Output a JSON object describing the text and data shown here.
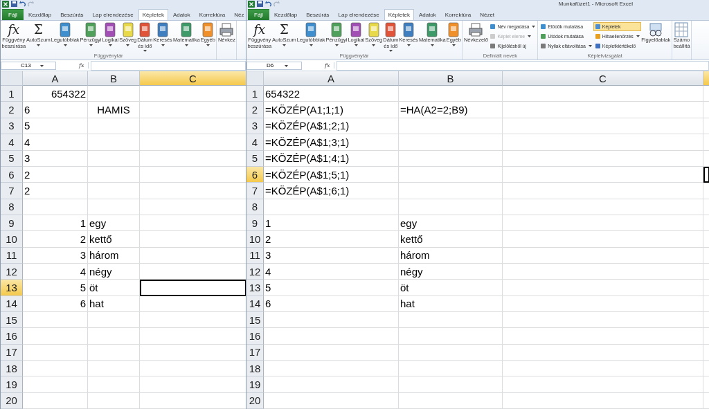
{
  "windows": [
    {
      "tabs": [
        {
          "label": "Fájl",
          "kind": "file",
          "selected": false
        },
        {
          "label": "Kezdőlap",
          "selected": false
        },
        {
          "label": "Beszúrás",
          "selected": false
        },
        {
          "label": "Lap elrendezése",
          "selected": false
        },
        {
          "label": "Képletek",
          "selected": true
        },
        {
          "label": "Adatok",
          "selected": false
        },
        {
          "label": "Korrektúra",
          "selected": false
        },
        {
          "label": "Néz",
          "selected": false
        }
      ],
      "ribbon": {
        "groups": [
          {
            "label": "Függvénytár",
            "buttons": [
              {
                "kind": "large",
                "lines": [
                  "Függvény",
                  "beszúrása"
                ],
                "glyph": "fx",
                "dropdown": false
              },
              {
                "kind": "large",
                "lines": [
                  "AutoSzum"
                ],
                "glyph": "Σ",
                "dropdown": true
              },
              {
                "kind": "large",
                "lines": [
                  "Legutóbbiak"
                ],
                "dropdown": true
              },
              {
                "kind": "large",
                "lines": [
                  "Pénzügyi"
                ],
                "dropdown": true
              },
              {
                "kind": "large",
                "lines": [
                  "Logikai"
                ],
                "dropdown": true
              },
              {
                "kind": "large",
                "lines": [
                  "Szöveg"
                ],
                "dropdown": true
              },
              {
                "kind": "large",
                "lines": [
                  "Dátum",
                  "és idő"
                ],
                "dropdown": true
              },
              {
                "kind": "large",
                "lines": [
                  "Keresés"
                ],
                "dropdown": true
              },
              {
                "kind": "large",
                "lines": [
                  "Matematika"
                ],
                "dropdown": true
              },
              {
                "kind": "large",
                "lines": [
                  "Egyéb"
                ],
                "dropdown": true
              }
            ]
          },
          {
            "buttons": [
              {
                "kind": "large",
                "lines": [
                  "Névkez"
                ],
                "dropdown": false
              }
            ]
          }
        ]
      },
      "name_box": "C13",
      "formula_bar": {
        "glyph": "fx"
      },
      "show_formulas": false,
      "columns": [
        {
          "label": "A",
          "selected": false
        },
        {
          "label": "B",
          "selected": false
        },
        {
          "label": "C",
          "selected": true
        }
      ],
      "rows": [
        {
          "number": "1",
          "selected": false,
          "cells": [
            {
              "text": "654322",
              "kind": "number"
            }
          ]
        },
        {
          "number": "2",
          "selected": false,
          "cells": [
            {
              "text": "6",
              "kind": "text"
            },
            {
              "text": "HAMIS",
              "kind": "logical"
            }
          ]
        },
        {
          "number": "3",
          "selected": false,
          "cells": [
            {
              "text": "5",
              "kind": "text"
            }
          ]
        },
        {
          "number": "4",
          "selected": false,
          "cells": [
            {
              "text": "4",
              "kind": "text"
            }
          ]
        },
        {
          "number": "5",
          "selected": false,
          "cells": [
            {
              "text": "3",
              "kind": "text"
            }
          ]
        },
        {
          "number": "6",
          "selected": false,
          "cells": [
            {
              "text": "2",
              "kind": "text"
            }
          ]
        },
        {
          "number": "7",
          "selected": false,
          "cells": [
            {
              "text": "2",
              "kind": "text"
            }
          ]
        },
        {
          "number": "8",
          "selected": false,
          "cells": []
        },
        {
          "number": "9",
          "selected": false,
          "cells": [
            {
              "text": "1",
              "kind": "number"
            },
            {
              "text": "egy",
              "kind": "text"
            }
          ]
        },
        {
          "number": "10",
          "selected": false,
          "cells": [
            {
              "text": "2",
              "kind": "number"
            },
            {
              "text": "kettő",
              "kind": "text"
            }
          ]
        },
        {
          "number": "11",
          "selected": false,
          "cells": [
            {
              "text": "3",
              "kind": "number"
            },
            {
              "text": "három",
              "kind": "text"
            }
          ]
        },
        {
          "number": "12",
          "selected": false,
          "cells": [
            {
              "text": "4",
              "kind": "number"
            },
            {
              "text": "négy",
              "kind": "text"
            }
          ]
        },
        {
          "number": "13",
          "selected": true,
          "cells": [
            {
              "text": "5",
              "kind": "number"
            },
            {
              "text": "öt",
              "kind": "text"
            },
            {
              "selected": true
            }
          ]
        },
        {
          "number": "14",
          "selected": false,
          "cells": [
            {
              "text": "6",
              "kind": "number"
            },
            {
              "text": "hat",
              "kind": "text"
            }
          ]
        },
        {
          "number": "15",
          "selected": false,
          "cells": []
        },
        {
          "number": "16",
          "selected": false,
          "cells": []
        },
        {
          "number": "17",
          "selected": false,
          "cells": []
        },
        {
          "number": "18",
          "selected": false,
          "cells": []
        },
        {
          "number": "19",
          "selected": false,
          "cells": []
        },
        {
          "number": "20",
          "selected": false,
          "cells": []
        }
      ]
    },
    {
      "title": "Munkafüzet1  -  Microsoft Excel",
      "tabs": [
        {
          "label": "Fájl",
          "kind": "file",
          "selected": false
        },
        {
          "label": "Kezdőlap",
          "selected": false
        },
        {
          "label": "Beszúrás",
          "selected": false
        },
        {
          "label": "Lap elrendezése",
          "selected": false
        },
        {
          "label": "Képletek",
          "selected": true
        },
        {
          "label": "Adatok",
          "selected": false
        },
        {
          "label": "Korrektúra",
          "selected": false
        },
        {
          "label": "Nézet",
          "selected": false
        }
      ],
      "ribbon": {
        "groups": [
          {
            "label": "Függvénytár",
            "buttons": [
              {
                "kind": "large",
                "lines": [
                  "Függvény",
                  "beszúrása"
                ],
                "glyph": "fx",
                "dropdown": false
              },
              {
                "kind": "large",
                "lines": [
                  "AutoSzum"
                ],
                "glyph": "Σ",
                "dropdown": true
              },
              {
                "kind": "large",
                "lines": [
                  "Legutóbbiak"
                ],
                "dropdown": true
              },
              {
                "kind": "large",
                "lines": [
                  "Pénzügyi"
                ],
                "dropdown": true
              },
              {
                "kind": "large",
                "lines": [
                  "Logikai"
                ],
                "dropdown": true
              },
              {
                "kind": "large",
                "lines": [
                  "Szöveg"
                ],
                "dropdown": true
              },
              {
                "kind": "large",
                "lines": [
                  "Dátum",
                  "és idő"
                ],
                "dropdown": true
              },
              {
                "kind": "large",
                "lines": [
                  "Keresés"
                ],
                "dropdown": true
              },
              {
                "kind": "large",
                "lines": [
                  "Matematika"
                ],
                "dropdown": true
              },
              {
                "kind": "large",
                "lines": [
                  "Egyéb"
                ],
                "dropdown": true
              }
            ]
          },
          {
            "label": "Definiált nevek",
            "buttons": [
              {
                "kind": "large",
                "lines": [
                  "Névkezelő"
                ],
                "dropdown": false
              },
              {
                "kind": "small",
                "lines": [
                  "Név megadása"
                ],
                "dropdown": true,
                "disabled": false
              },
              {
                "kind": "small",
                "lines": [
                  "Képlet eleme"
                ],
                "dropdown": true,
                "disabled": true
              },
              {
                "kind": "small",
                "lines": [
                  "Kijelölésből új"
                ],
                "dropdown": false,
                "disabled": false
              }
            ]
          },
          {
            "label": "Képletvizsgálat",
            "buttons": [
              {
                "kind": "small",
                "lines": [
                  "Elődök mutatása"
                ],
                "dropdown": false,
                "selected": false
              },
              {
                "kind": "small",
                "lines": [
                  "Utódok mutatása"
                ],
                "dropdown": false,
                "selected": false
              },
              {
                "kind": "small",
                "lines": [
                  "Nyilak eltávolítása"
                ],
                "dropdown": true,
                "selected": false
              },
              {
                "kind": "small",
                "lines": [
                  "Képletek"
                ],
                "dropdown": false,
                "selected": true
              },
              {
                "kind": "small",
                "lines": [
                  "Hibaellenőrzés"
                ],
                "dropdown": true,
                "selected": false
              },
              {
                "kind": "small",
                "lines": [
                  "Képletkiértékelő"
                ],
                "dropdown": false,
                "selected": false
              },
              {
                "kind": "large",
                "lines": [
                  "Figyelőablak"
                ],
                "dropdown": false
              }
            ]
          },
          {
            "buttons": [
              {
                "kind": "large",
                "lines": [
                  "Számo",
                  "beállítá"
                ],
                "dropdown": false
              }
            ]
          }
        ]
      },
      "name_box": "D6",
      "formula_bar": {
        "glyph": "fx"
      },
      "show_formulas": true,
      "columns": [
        {
          "label": "A",
          "selected": false
        },
        {
          "label": "B",
          "selected": false
        },
        {
          "label": "C",
          "selected": false
        },
        {
          "selected": true
        }
      ],
      "rows": [
        {
          "number": "1",
          "selected": false,
          "cells": [
            {
              "text": "654322",
              "kind": "number"
            }
          ]
        },
        {
          "number": "2",
          "selected": false,
          "cells": [
            {
              "text": "=KÖZÉP(A1;1;1)",
              "kind": "text"
            },
            {
              "text": "=HA(A2=2;B9)",
              "kind": "text"
            }
          ]
        },
        {
          "number": "3",
          "selected": false,
          "cells": [
            {
              "text": "=KÖZÉP(A$1;2;1)",
              "kind": "text"
            }
          ]
        },
        {
          "number": "4",
          "selected": false,
          "cells": [
            {
              "text": "=KÖZÉP(A$1;3;1)",
              "kind": "text"
            }
          ]
        },
        {
          "number": "5",
          "selected": false,
          "cells": [
            {
              "text": "=KÖZÉP(A$1;4;1)",
              "kind": "text"
            }
          ]
        },
        {
          "number": "6",
          "selected": true,
          "cells": [
            {
              "text": "=KÖZÉP(A$1;5;1)",
              "kind": "text"
            },
            null,
            null,
            {
              "selected": true
            }
          ]
        },
        {
          "number": "7",
          "selected": false,
          "cells": [
            {
              "text": "=KÖZÉP(A$1;6;1)",
              "kind": "text"
            }
          ]
        },
        {
          "number": "8",
          "selected": false,
          "cells": []
        },
        {
          "number": "9",
          "selected": false,
          "cells": [
            {
              "text": "1",
              "kind": "number"
            },
            {
              "text": "egy",
              "kind": "text"
            }
          ]
        },
        {
          "number": "10",
          "selected": false,
          "cells": [
            {
              "text": "2",
              "kind": "number"
            },
            {
              "text": "kettő",
              "kind": "text"
            }
          ]
        },
        {
          "number": "11",
          "selected": false,
          "cells": [
            {
              "text": "3",
              "kind": "number"
            },
            {
              "text": "három",
              "kind": "text"
            }
          ]
        },
        {
          "number": "12",
          "selected": false,
          "cells": [
            {
              "text": "4",
              "kind": "number"
            },
            {
              "text": "négy",
              "kind": "text"
            }
          ]
        },
        {
          "number": "13",
          "selected": false,
          "cells": [
            {
              "text": "5",
              "kind": "number"
            },
            {
              "text": "öt",
              "kind": "text"
            }
          ]
        },
        {
          "number": "14",
          "selected": false,
          "cells": [
            {
              "text": "6",
              "kind": "number"
            },
            {
              "text": "hat",
              "kind": "text"
            }
          ]
        },
        {
          "number": "15",
          "selected": false,
          "cells": []
        },
        {
          "number": "16",
          "selected": false,
          "cells": []
        },
        {
          "number": "17",
          "selected": false,
          "cells": []
        },
        {
          "number": "18",
          "selected": false,
          "cells": []
        },
        {
          "number": "19",
          "selected": false,
          "cells": []
        },
        {
          "number": "20",
          "selected": false,
          "cells": []
        }
      ]
    }
  ]
}
